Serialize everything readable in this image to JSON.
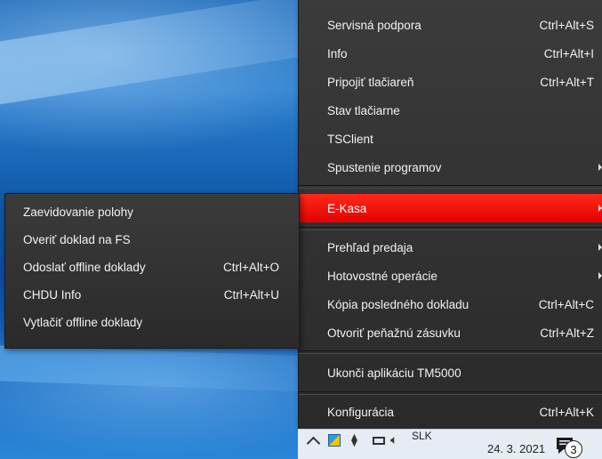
{
  "main_menu": {
    "items": [
      {
        "label": "Servisná podpora",
        "shortcut": "Ctrl+Alt+S"
      },
      {
        "label": "Info",
        "shortcut": "Ctrl+Alt+I"
      },
      {
        "label": "Pripojiť tlačiareň",
        "shortcut": "Ctrl+Alt+T"
      },
      {
        "label": "Stav tlačiarne",
        "shortcut": ""
      },
      {
        "label": "TSClient",
        "shortcut": ""
      },
      {
        "label": "Spustenie programov",
        "shortcut": "",
        "has_submenu": true
      },
      {
        "label": "E-Kasa",
        "shortcut": "",
        "has_submenu": true,
        "active": true
      },
      {
        "label": "Prehľad predaja",
        "shortcut": "",
        "has_submenu": true
      },
      {
        "label": "Hotovostné operácie",
        "shortcut": "",
        "has_submenu": true
      },
      {
        "label": "Kópia posledného dokladu",
        "shortcut": "Ctrl+Alt+C"
      },
      {
        "label": "Otvoriť peňažnú zásuvku",
        "shortcut": "Ctrl+Alt+Z"
      },
      {
        "label": "Ukonči aplikáciu TM5000",
        "shortcut": ""
      },
      {
        "label": "Konfigurácia",
        "shortcut": "Ctrl+Alt+K"
      }
    ]
  },
  "submenu": {
    "items": [
      {
        "label": "Zaevidovanie polohy",
        "shortcut": ""
      },
      {
        "label": "Overiť doklad na FS",
        "shortcut": ""
      },
      {
        "label": "Odoslať offline doklady",
        "shortcut": "Ctrl+Alt+O"
      },
      {
        "label": "CHDU Info",
        "shortcut": "Ctrl+Alt+U"
      },
      {
        "label": "Vytlačiť offline doklady",
        "shortcut": ""
      }
    ]
  },
  "taskbar": {
    "language": "SLK",
    "date": "24. 3. 2021",
    "notification_count": "3",
    "tray_icons": [
      "chevron-up-icon",
      "shield-icon",
      "wifi-icon",
      "battery-icon",
      "speaker-icon",
      "notification-icon"
    ]
  },
  "colors": {
    "menu_background": "#2f2f2f",
    "highlight": "#ff1a0a",
    "taskbar": "#e6ecf3"
  }
}
